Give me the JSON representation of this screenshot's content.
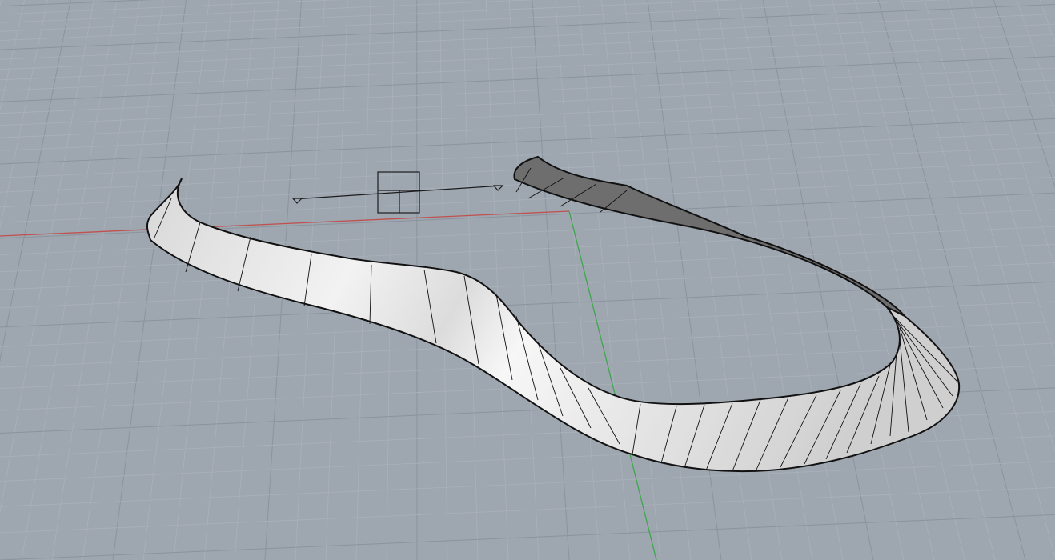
{
  "viewport": {
    "view": "perspective",
    "background_color": "#9ea6b0",
    "grid": true,
    "grid_minor_color": "#aab1ba",
    "grid_major_color": "#8b939e",
    "x_axis_color": "#c0504d",
    "y_axis_color": "#3aa84a",
    "surface_color": "#e6e6e6",
    "surface_dark_color": "#6e6e6e",
    "edge_color": "#111111"
  },
  "objects": {
    "surface": {
      "name": "ribbon-surface",
      "type": "loft-surface",
      "isocurves": true
    },
    "camera": {
      "name": "camera-widget",
      "icon": "camera-frame-icon"
    }
  }
}
